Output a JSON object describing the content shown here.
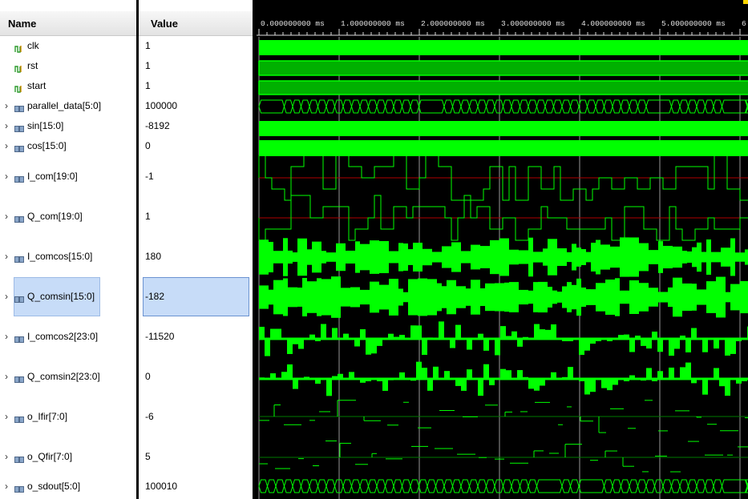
{
  "header": {
    "name_col": "Name",
    "value_col": "Value"
  },
  "time_ruler": [
    "0.000000000 ms",
    "1.000000000 ms",
    "2.000000000 ms",
    "3.000000000 ms",
    "4.000000000 ms",
    "5.000000000 ms",
    "6."
  ],
  "signals": [
    {
      "name": "clk",
      "value": "1",
      "type": "bit",
      "expandable": false
    },
    {
      "name": "rst",
      "value": "1",
      "type": "bit",
      "expandable": false
    },
    {
      "name": "start",
      "value": "1",
      "type": "bit",
      "expandable": false
    },
    {
      "name": "parallel_data[5:0]",
      "value": "100000",
      "type": "bus",
      "expandable": true
    },
    {
      "name": "sin[15:0]",
      "value": "-8192",
      "type": "bus",
      "expandable": true
    },
    {
      "name": "cos[15:0]",
      "value": "0",
      "type": "bus",
      "expandable": true
    },
    {
      "name": "I_com[19:0]",
      "value": "-1",
      "type": "analog",
      "expandable": true
    },
    {
      "name": "Q_com[19:0]",
      "value": "1",
      "type": "analog",
      "expandable": true
    },
    {
      "name": "I_comcos[15:0]",
      "value": "180",
      "type": "analog",
      "expandable": true
    },
    {
      "name": "Q_comsin[15:0]",
      "value": "-182",
      "type": "analog",
      "expandable": true,
      "selected": true
    },
    {
      "name": "I_comcos2[23:0]",
      "value": "-11520",
      "type": "analog",
      "expandable": true
    },
    {
      "name": "Q_comsin2[23:0]",
      "value": "0",
      "type": "analog",
      "expandable": true
    },
    {
      "name": "o_Ifir[7:0]",
      "value": "-6",
      "type": "analog",
      "expandable": true
    },
    {
      "name": "o_Qfir[7:0]",
      "value": "5",
      "type": "analog",
      "expandable": true
    },
    {
      "name": "o_sdout[5:0]",
      "value": "100010",
      "type": "bus",
      "expandable": true
    }
  ],
  "colors": {
    "wave": "#00ff00",
    "wave_dim": "#00cc00",
    "grid": "#bfbfbf",
    "selection": "#c7dcf8",
    "cursor": "#ffd700"
  }
}
